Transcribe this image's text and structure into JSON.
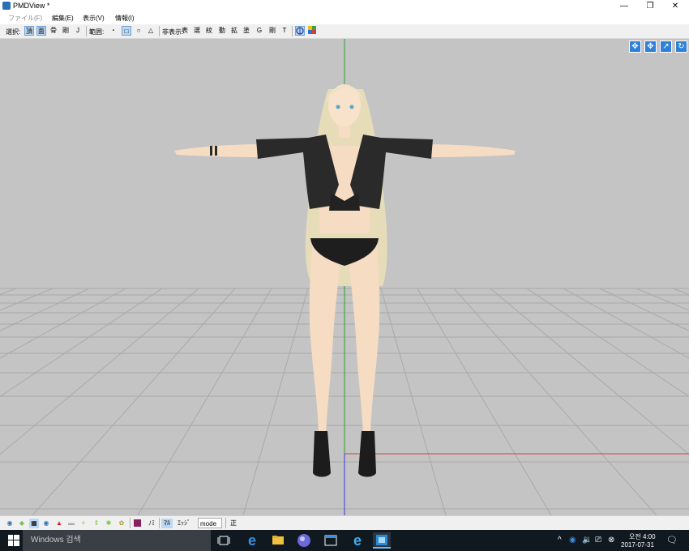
{
  "window": {
    "title": "PMDView *"
  },
  "menu": [
    {
      "label": "ファイル(F)",
      "dim": true
    },
    {
      "label": "編集(E)"
    },
    {
      "label": "表示(V)"
    },
    {
      "label": "情報(I)"
    }
  ],
  "toolbar": {
    "select_label": "選択:",
    "select_buttons": [
      "頂",
      "面",
      "骨",
      "剛",
      "J"
    ],
    "range_label": "範囲:",
    "range_buttons": [
      "・",
      "□",
      "○",
      "△"
    ],
    "hide_label": "非表示:",
    "hide_buttons": [
      "表",
      "選",
      "紋",
      "動",
      "拡",
      "塗",
      "G",
      "剛",
      "T"
    ]
  },
  "bottom_toolbar": {
    "labels": [
      "ﾉﾐ",
      "ﾏﾙ",
      "ｴｯｼﾞ"
    ],
    "mode_label": "mode",
    "snap_label": "正"
  },
  "taskbar": {
    "search_placeholder": "Windows 검색",
    "time": "오전 4:00",
    "date": "2017-07-31"
  },
  "colors": {
    "viewport_bg": "#c4c4c4",
    "grid": "#a7a7a7",
    "y_axis": "#2aa02a",
    "x_axis": "#d84040",
    "z_axis": "#3a3ad8"
  }
}
